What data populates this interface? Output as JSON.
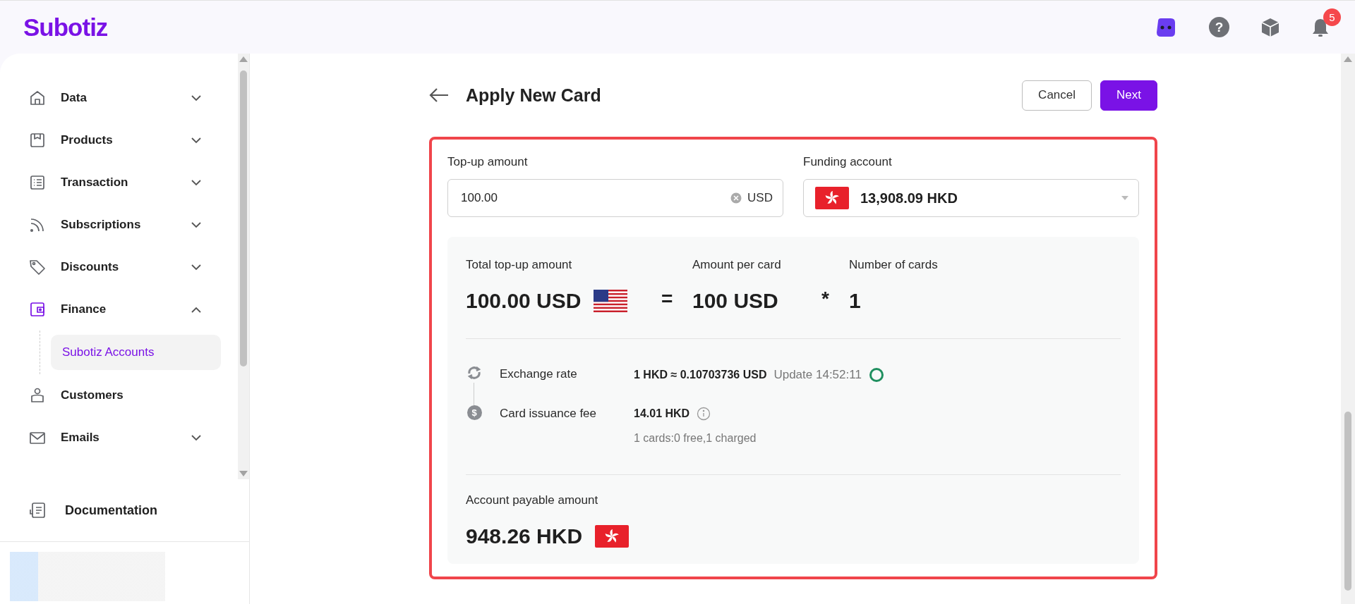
{
  "header": {
    "logo": "Subotiz",
    "help_glyph": "?",
    "notification_count": "5"
  },
  "sidebar": {
    "items": [
      {
        "label": "Data",
        "kind": "group",
        "expanded": false,
        "selected": false
      },
      {
        "label": "Products",
        "kind": "group",
        "expanded": false,
        "selected": false
      },
      {
        "label": "Transaction",
        "kind": "group",
        "expanded": false,
        "selected": false
      },
      {
        "label": "Subscriptions",
        "kind": "group",
        "expanded": false,
        "selected": false
      },
      {
        "label": "Discounts",
        "kind": "group",
        "expanded": false,
        "selected": false
      },
      {
        "label": "Finance",
        "kind": "group",
        "expanded": true,
        "selected": true,
        "children": [
          {
            "label": "Subotiz Accounts",
            "selected": true
          }
        ]
      },
      {
        "label": "Customers",
        "kind": "link",
        "selected": false
      },
      {
        "label": "Emails",
        "kind": "group",
        "expanded": false,
        "selected": false
      }
    ],
    "footer_link": "Documentation"
  },
  "page": {
    "title": "Apply New Card",
    "buttons": [
      {
        "label": "Cancel",
        "kind": "secondary"
      },
      {
        "label": "Next",
        "kind": "primary"
      }
    ]
  },
  "form": {
    "topup": {
      "label": "Top-up amount",
      "value": "100.00",
      "currency": "USD"
    },
    "funding": {
      "label": "Funding account",
      "value": "13,908.09 HKD"
    }
  },
  "summary": {
    "total_label": "Total top-up amount",
    "total": "100.00 USD",
    "equals": "=",
    "per_card_label": "Amount per card",
    "per_card": "100 USD",
    "times": "*",
    "count_label": "Number of cards",
    "count": "1",
    "details": [
      {
        "kind": "rate",
        "label": "Exchange rate",
        "value": "1 HKD ≈ 0.10703736 USD",
        "note": "Update 14:52:11"
      },
      {
        "kind": "fee",
        "icon_glyph": "$",
        "label": "Card issuance fee",
        "value": "14.01 HKD",
        "note": "1 cards:0 free,1 charged"
      }
    ],
    "payable_label": "Account payable amount",
    "payable": "948.26 HKD"
  }
}
